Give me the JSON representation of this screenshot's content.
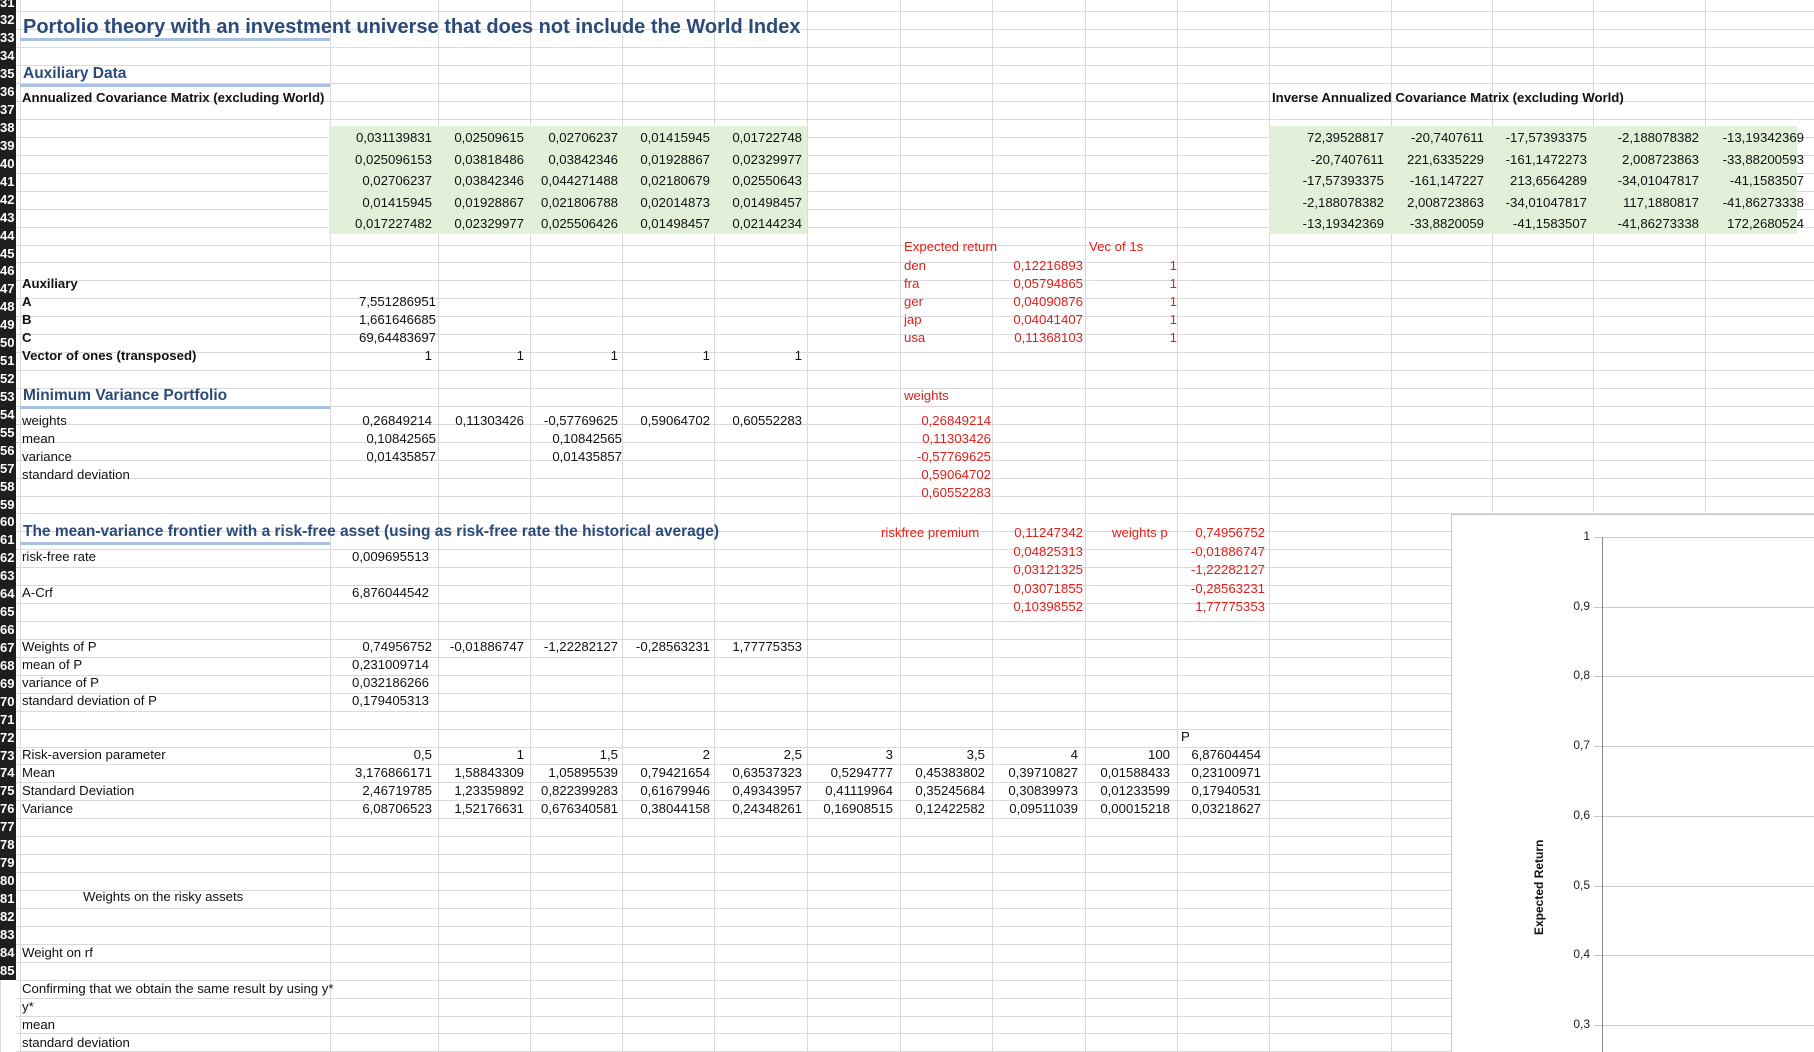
{
  "row_numbers": [
    "31",
    "32",
    "33",
    "34",
    "35",
    "36",
    "37",
    "38",
    "39",
    "40",
    "41",
    "42",
    "43",
    "44",
    "45",
    "46",
    "47",
    "48",
    "49",
    "50",
    "51",
    "52",
    "53",
    "54",
    "55",
    "56",
    "57",
    "58",
    "59",
    "60",
    "61",
    "62",
    "63",
    "64",
    "65",
    "66",
    "67",
    "68",
    "69",
    "70",
    "71",
    "72",
    "73",
    "74",
    "75",
    "76",
    "77",
    "78",
    "79",
    "80",
    "81",
    "82",
    "83",
    "84",
    "85"
  ],
  "headings": {
    "main_title": "Portolio theory with an investment universe that does not include the World Index",
    "auxiliary_data": "Auxiliary Data",
    "cov_label": "Annualized Covariance Matrix (excluding World)",
    "inv_cov_label": "Inverse Annualized Covariance Matrix (excluding World)",
    "min_var": "Minimum Variance Portfolio",
    "frontier": "The mean-variance frontier with a risk-free asset (using as risk-free rate the historical average)"
  },
  "cov_matrix": [
    [
      "0,031139831",
      "0,02509615",
      "0,02706237",
      "0,01415945",
      "0,01722748"
    ],
    [
      "0,025096153",
      "0,03818486",
      "0,03842346",
      "0,01928867",
      "0,02329977"
    ],
    [
      "0,02706237",
      "0,03842346",
      "0,044271488",
      "0,02180679",
      "0,02550643"
    ],
    [
      "0,01415945",
      "0,01928867",
      "0,021806788",
      "0,02014873",
      "0,01498457"
    ],
    [
      "0,017227482",
      "0,02329977",
      "0,025506426",
      "0,01498457",
      "0,02144234"
    ]
  ],
  "inv_cov_matrix": [
    [
      "72,39528817",
      "-20,7407611",
      "-17,57393375",
      "-2,188078382",
      "-13,19342369"
    ],
    [
      "-20,7407611",
      "221,6335229",
      "-161,1472273",
      "2,008723863",
      "-33,88200593"
    ],
    [
      "-17,57393375",
      "-161,147227",
      "213,6564289",
      "-34,01047817",
      "-41,1583507"
    ],
    [
      "-2,188078382",
      "2,008723863",
      "-34,01047817",
      "117,1880817",
      "-41,86273338"
    ],
    [
      "-13,19342369",
      "-33,8820059",
      "-41,1583507",
      "-41,86273338",
      "172,2680524"
    ]
  ],
  "expected_return": {
    "header": "Expected return",
    "vec_header": "Vec of 1s",
    "rows": [
      {
        "name": "den",
        "value": "0,12216893",
        "one": "1"
      },
      {
        "name": "fra",
        "value": "0,05794865",
        "one": "1"
      },
      {
        "name": "ger",
        "value": "0,04090876",
        "one": "1"
      },
      {
        "name": "jap",
        "value": "0,04041407",
        "one": "1"
      },
      {
        "name": "usa",
        "value": "0,11368103",
        "one": "1"
      }
    ]
  },
  "auxiliary": {
    "label": "Auxiliary",
    "a_label": "A",
    "a_value": "7,551286951",
    "b_label": "B",
    "b_value": "1,661646685",
    "c_label": "C",
    "c_value": "69,64483697",
    "ones_label": "Vector of ones (transposed)",
    "ones": [
      "1",
      "1",
      "1",
      "1",
      "1"
    ]
  },
  "min_variance": {
    "weights_label": "weights",
    "weights": [
      "0,26849214",
      "0,11303426",
      "-0,57769625",
      "0,59064702",
      "0,60552283"
    ],
    "mean_label": "mean",
    "mean_a": "0,10842565",
    "mean_b": "0,10842565",
    "variance_label": "variance",
    "variance_a": "0,01435857",
    "variance_b": "0,01435857",
    "sd_label": "standard deviation",
    "side_header": "weights",
    "side_weights": [
      "0,26849214",
      "0,11303426",
      "-0,57769625",
      "0,59064702",
      "0,60552283"
    ]
  },
  "frontier": {
    "rf_label": "risk-free rate",
    "rf_value": "0,009695513",
    "acrf_label": "A-Crf",
    "acrf_value": "6,876044542",
    "premium_label": "riskfree premium",
    "premiums": [
      "0,11247342",
      "0,04825313",
      "0,03121325",
      "0,03071855",
      "0,10398552"
    ],
    "weights_p_label": "weights p",
    "weights_p": [
      "0,74956752",
      "-0,01886747",
      "-1,22282127",
      "-0,28563231",
      "1,77775353"
    ],
    "wp_label": "Weights of P",
    "wp": [
      "0,74956752",
      "-0,01886747",
      "-1,22282127",
      "-0,28563231",
      "1,77775353"
    ],
    "mean_p_label": "mean of P",
    "mean_p": "0,231009714",
    "var_p_label": "variance of P",
    "var_p": "0,032186266",
    "sd_p_label": "standard deviation of P",
    "sd_p": "0,179405313"
  },
  "risk_table": {
    "p_header": "P",
    "rows": [
      {
        "label": "Risk-aversion parameter",
        "values": [
          "0,5",
          "1",
          "1,5",
          "2",
          "2,5",
          "3",
          "3,5",
          "4",
          "100",
          "6,87604454"
        ]
      },
      {
        "label": "Mean",
        "values": [
          "3,176866171",
          "1,58843309",
          "1,05895539",
          "0,79421654",
          "0,63537323",
          "0,5294777",
          "0,45383802",
          "0,39710827",
          "0,01588433",
          "0,23100971"
        ]
      },
      {
        "label": "Standard Deviation",
        "values": [
          "2,46719785",
          "1,23359892",
          "0,822399283",
          "0,61679946",
          "0,49343957",
          "0,41119964",
          "0,35245684",
          "0,30839973",
          "0,01233599",
          "0,17940531"
        ]
      },
      {
        "label": "Variance",
        "values": [
          "6,08706523",
          "1,52176631",
          "0,676340581",
          "0,38044158",
          "0,24348261",
          "0,16908515",
          "0,12422582",
          "0,09511039",
          "0,00015218",
          "0,03218627"
        ]
      }
    ]
  },
  "lower": {
    "weights_risky": "Weights on the risky assets",
    "weight_rf": "Weight on rf",
    "confirm": "Confirming that we obtain the same result by using y*",
    "ystar": "y*",
    "mean": "mean",
    "sd": "standard deviation"
  },
  "chart_data": {
    "type": "line",
    "ylabel": "Expected Return",
    "y_ticks": [
      "1",
      "0,9",
      "0,8",
      "0,7",
      "0,6",
      "0,5",
      "0,4",
      "0,3"
    ],
    "ylim": [
      0.3,
      1
    ],
    "grid": true,
    "series": []
  },
  "colors": {
    "green_fill": "#e2efd9",
    "title_blue": "#2b4a7a",
    "red_text": "#e0201a",
    "row_header": "#1e1e1e"
  }
}
